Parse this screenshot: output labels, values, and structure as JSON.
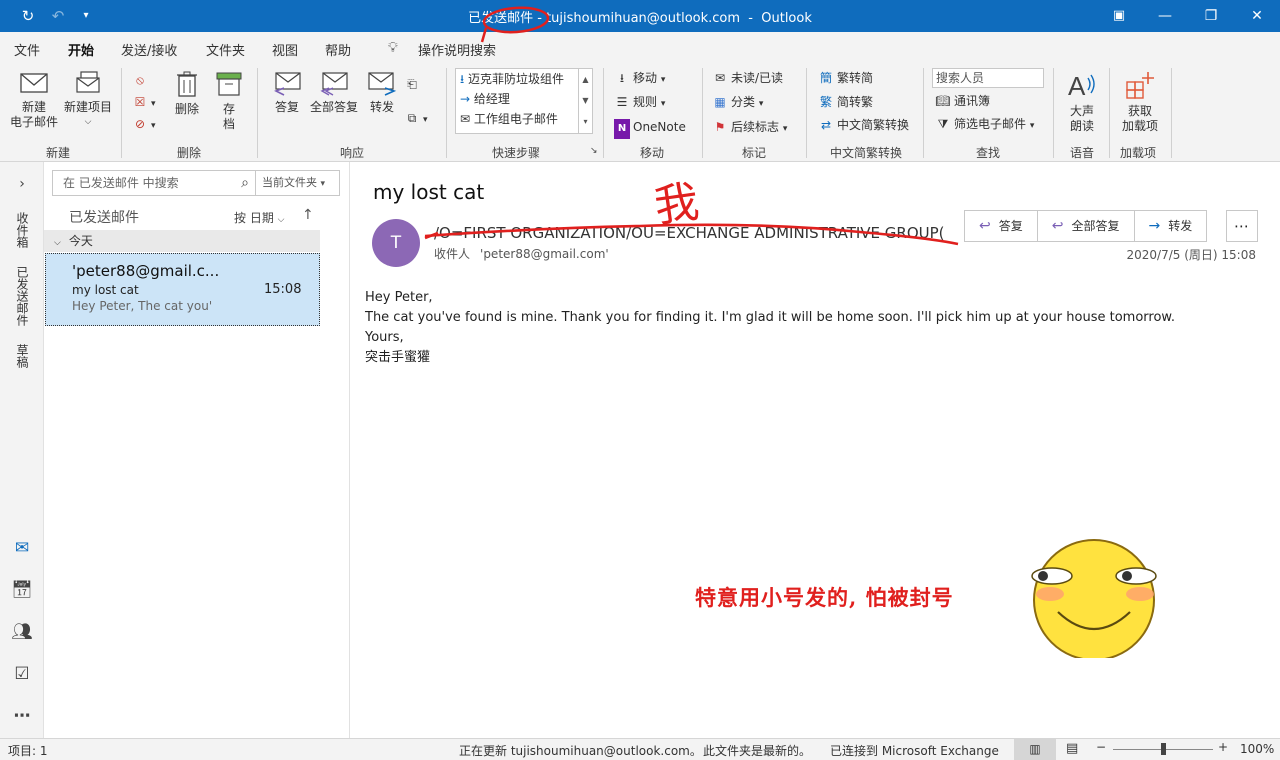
{
  "window": {
    "title": "已发送邮件 - tujishoumihuan@outlook.com  -  Outlook",
    "accent": "#0f6cbd"
  },
  "menu": {
    "tabs": [
      "文件",
      "开始",
      "发送/接收",
      "文件夹",
      "视图",
      "帮助"
    ],
    "active": "开始",
    "tell_me": "操作说明搜索"
  },
  "ribbon": {
    "new_email": "新建\n电子邮件",
    "new_items": "新建项目",
    "group_new": "新建",
    "delete": "删除",
    "archive": "存\n档",
    "group_delete": "删除",
    "reply": "答复",
    "reply_all": "全部答复",
    "forward": "转发",
    "group_respond": "响应",
    "quick_steps": [
      "迈克菲防垃圾组件",
      "给经理",
      "工作组电子邮件"
    ],
    "group_quick_steps": "快速步骤",
    "move": "移动",
    "rules": "规则",
    "onenote": "OneNote",
    "group_move": "移动",
    "unread_read": "未读/已读",
    "categorize": "分类",
    "follow_up": "后续标志",
    "group_tags": "标记",
    "trad_to_simp": "繁转简",
    "simp_to_trad": "简转繁",
    "convert": "中文简繁转换",
    "group_chinese": "中文简繁转换",
    "search_people": "搜索人员",
    "address_book": "通讯簿",
    "filter_email": "筛选电子邮件",
    "group_find": "查找",
    "read_aloud": "大声\n朗读",
    "group_speech": "语音",
    "get_addins": "获取\n加载项",
    "group_addins": "加载项"
  },
  "nav": {
    "inbox": "收件箱",
    "sent": "已发送邮件",
    "drafts": "草稿"
  },
  "list": {
    "search_placeholder": "在 已发送邮件 中搜索",
    "scope": "当前文件夹",
    "folder": "已发送邮件",
    "sort": "按 日期",
    "group": "今天",
    "items": [
      {
        "from": "'peter88@gmail.c...",
        "subject": "my lost cat",
        "time": "15:08",
        "preview": "Hey Peter,  The cat you'"
      }
    ]
  },
  "reading": {
    "subject": "my lost cat",
    "avatar_initial": "T",
    "sender": "/O=FIRST ORGANIZATION/OU=EXCHANGE ADMINISTRATIVE GROUP(F",
    "to_label": "收件人",
    "to_value": "'peter88@gmail.com'",
    "reply": "答复",
    "reply_all": "全部答复",
    "forward": "转发",
    "date": "2020/7/5 (周日) 15:08",
    "body": [
      "Hey Peter,",
      "The cat you've found is mine. Thank you for finding it. I'm glad it will be home soon. I'll pick him up at your house tomorrow.",
      "Yours,",
      "突击手蜜獾"
    ],
    "annotation": "特意用小号发的, 怕被封号",
    "handwritten": "我"
  },
  "status": {
    "items": "项目: 1",
    "updating": "正在更新 tujishoumihuan@outlook.com。",
    "uptodate": "此文件夹是最新的。",
    "connected": "已连接到 Microsoft Exchange",
    "zoom": "100%"
  }
}
